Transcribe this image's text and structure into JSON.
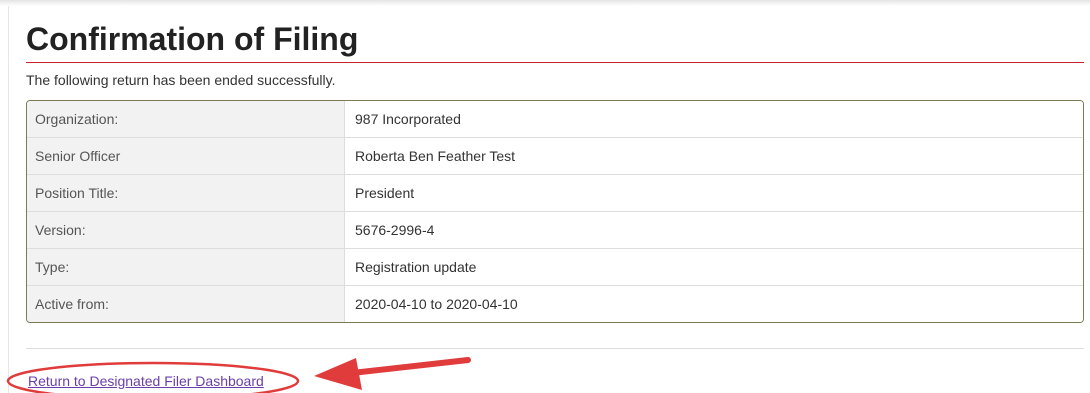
{
  "page": {
    "title": "Confirmation of Filing",
    "intro": "The following return has been ended successfully."
  },
  "details": {
    "rows": [
      {
        "label": "Organization:",
        "value": "987 Incorporated"
      },
      {
        "label": "Senior Officer",
        "value": "Roberta Ben Feather Test"
      },
      {
        "label": "Position Title:",
        "value": "President"
      },
      {
        "label": "Version:",
        "value": "5676-2996-4"
      },
      {
        "label": "Type:",
        "value": "Registration update"
      },
      {
        "label": "Active from:",
        "value": "2020-04-10 to 2020-04-10"
      }
    ]
  },
  "footer": {
    "link_label": "Return to Designated Filer Dashboard"
  },
  "colors": {
    "title_rule": "#c8232c",
    "table_border": "#7a7a55",
    "link": "#6a3ea8",
    "annotation": "#e03c3c"
  }
}
